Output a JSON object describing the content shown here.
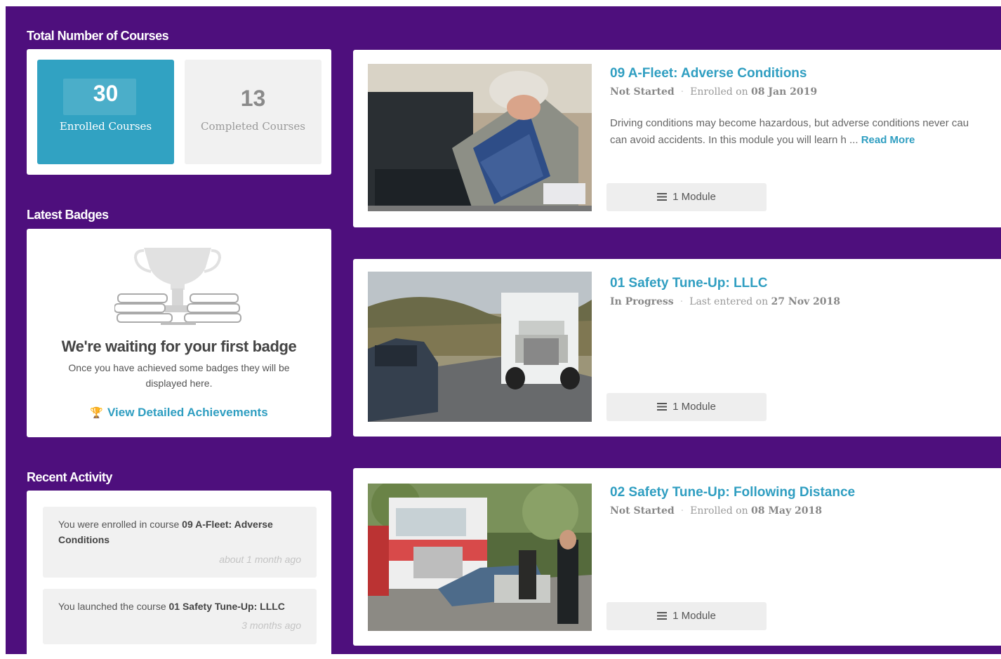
{
  "stats": {
    "title": "Total Number of Courses",
    "enrolled_count": "30",
    "enrolled_label": "Enrolled Courses",
    "completed_count": "13",
    "completed_label": "Completed Courses",
    "enrolled_color": "#31a2c2"
  },
  "badges": {
    "title": "Latest Badges",
    "heading": "We're waiting for your first badge",
    "message": "Once you have achieved some badges they will be displayed here.",
    "link_label": "View Detailed Achievements"
  },
  "activity": {
    "title": "Recent Activity",
    "items": [
      {
        "prefix": "You were enrolled in course ",
        "course": "09 A-Fleet: Adverse Conditions",
        "time": "about 1 month ago"
      },
      {
        "prefix": "You launched the course ",
        "course": "01 Safety Tune-Up: LLLC",
        "time": "3 months ago"
      }
    ]
  },
  "courses": [
    {
      "title": "09 A-Fleet: Adverse Conditions",
      "status": "Not Started",
      "date_prefix": "Enrolled on ",
      "date": "08 Jan 2019",
      "desc_line1": "Driving conditions may become hazardous, but adverse conditions never cau",
      "desc_line2": "can avoid accidents. In this module you will learn h ... ",
      "read_more": "Read More",
      "modules": "1 Module",
      "thumb_icon": "mechanic-engine-photo"
    },
    {
      "title": "01 Safety Tune-Up: LLLC",
      "status": "In Progress",
      "date_prefix": "Last entered on ",
      "date": "27 Nov 2018",
      "modules": "1 Module",
      "thumb_icon": "truck-road-photo"
    },
    {
      "title": "02 Safety Tune-Up: Following Distance",
      "status": "Not Started",
      "date_prefix": "Enrolled on ",
      "date": "08 May 2018",
      "modules": "1 Module",
      "thumb_icon": "truck-accident-photo"
    }
  ],
  "colors": {
    "background": "#4e0f7d",
    "accent": "#2f9ec1"
  }
}
